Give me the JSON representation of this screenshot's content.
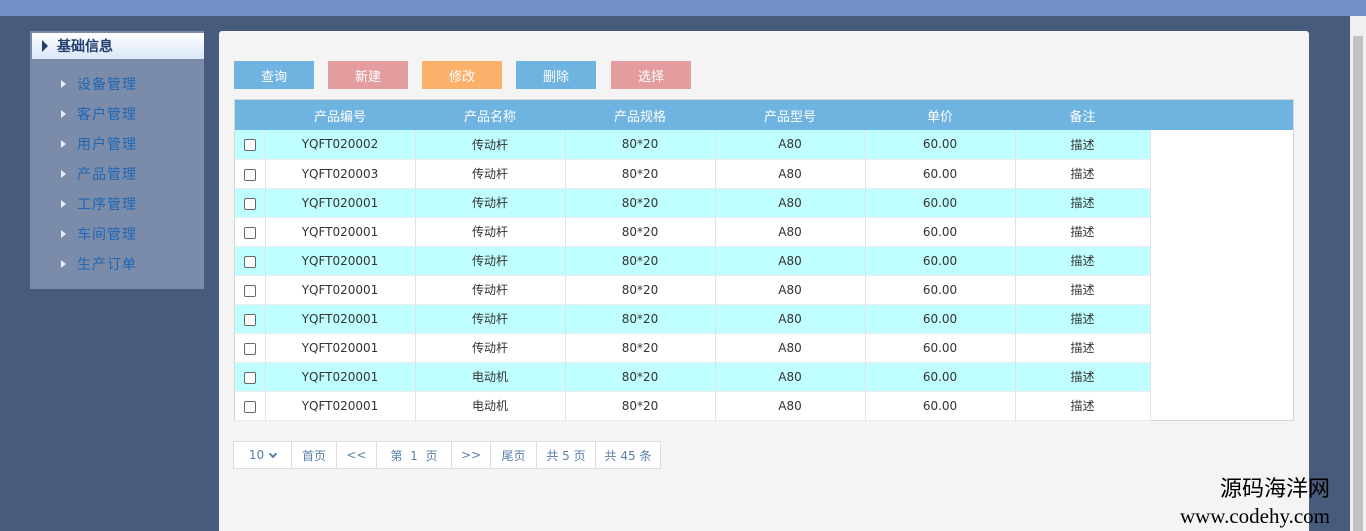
{
  "sidebar": {
    "header": "基础信息",
    "items": [
      {
        "label": "设备管理"
      },
      {
        "label": "客户管理"
      },
      {
        "label": "用户管理"
      },
      {
        "label": "产品管理"
      },
      {
        "label": "工序管理"
      },
      {
        "label": "车间管理"
      },
      {
        "label": "生产订单"
      }
    ]
  },
  "toolbar": {
    "buttons": [
      {
        "label": "查询",
        "color": "#6fb3e0"
      },
      {
        "label": "新建",
        "color": "#e39d9f"
      },
      {
        "label": "修改",
        "color": "#fbb16a"
      },
      {
        "label": "删除",
        "color": "#6fb3e0"
      },
      {
        "label": "选择",
        "color": "#e39d9f"
      }
    ]
  },
  "table": {
    "columns": [
      "",
      "产品编号",
      "产品名称",
      "产品规格",
      "产品型号",
      "单价",
      "备注"
    ],
    "rows": [
      [
        "YQFT020002",
        "传动杆",
        "80*20",
        "A80",
        "60.00",
        "描述"
      ],
      [
        "YQFT020003",
        "传动杆",
        "80*20",
        "A80",
        "60.00",
        "描述"
      ],
      [
        "YQFT020001",
        "传动杆",
        "80*20",
        "A80",
        "60.00",
        "描述"
      ],
      [
        "YQFT020001",
        "传动杆",
        "80*20",
        "A80",
        "60.00",
        "描述"
      ],
      [
        "YQFT020001",
        "传动杆",
        "80*20",
        "A80",
        "60.00",
        "描述"
      ],
      [
        "YQFT020001",
        "传动杆",
        "80*20",
        "A80",
        "60.00",
        "描述"
      ],
      [
        "YQFT020001",
        "传动杆",
        "80*20",
        "A80",
        "60.00",
        "描述"
      ],
      [
        "YQFT020001",
        "传动杆",
        "80*20",
        "A80",
        "60.00",
        "描述"
      ],
      [
        "YQFT020001",
        "电动机",
        "80*20",
        "A80",
        "60.00",
        "描述"
      ],
      [
        "YQFT020001",
        "电动机",
        "80*20",
        "A80",
        "60.00",
        "描述"
      ]
    ]
  },
  "pager": {
    "page_size": "10",
    "first": "首页",
    "prev": "<<",
    "current": "第  1  页",
    "next": ">>",
    "last": "尾页",
    "total_pages": "共 5 页",
    "total_items": "共 45 条"
  },
  "watermark": {
    "line1": "源码海洋网",
    "line2": "www.codehy.com"
  }
}
